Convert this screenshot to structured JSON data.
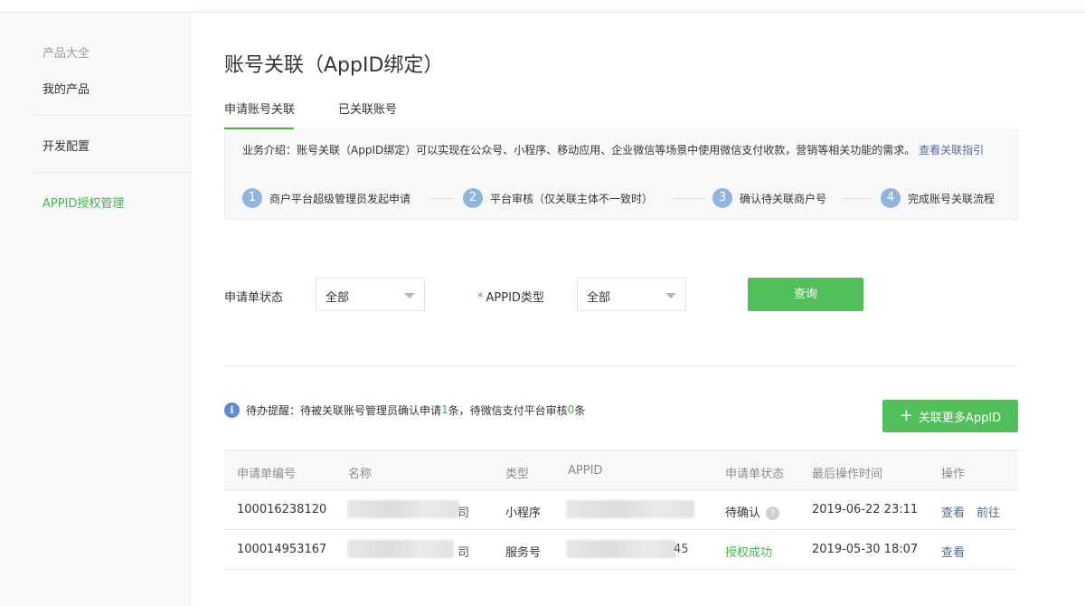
{
  "sidebar": {
    "caption": "产品大全",
    "items": [
      {
        "label": "我的产品"
      },
      {
        "label": "开发配置"
      },
      {
        "label": "APPID授权管理"
      }
    ]
  },
  "page": {
    "title": "账号关联（AppID绑定）"
  },
  "tabs": [
    {
      "label": "申请账号关联",
      "active": true
    },
    {
      "label": "已关联账号",
      "active": false
    }
  ],
  "intro": {
    "text": "业务介绍：账号关联（AppID绑定）可以实现在公众号、小程序、移动应用、企业微信等场景中使用微信支付收款，营销等相关功能的需求。",
    "link": "查看关联指引",
    "steps": [
      {
        "num": "1",
        "label": "商户平台超级管理员发起申请"
      },
      {
        "num": "2",
        "label": "平台审核（仅关联主体不一致时）"
      },
      {
        "num": "3",
        "label": "确认待关联商户号"
      },
      {
        "num": "4",
        "label": "完成账号关联流程"
      }
    ]
  },
  "filters": {
    "status_label": "申请单状态",
    "status_value": "全部",
    "required_mark": "*",
    "type_label": "APPID类型",
    "type_value": "全部",
    "query_button": "查询"
  },
  "notice": {
    "prefix": "待办提醒：待被关联账号管理员确认申请",
    "count1": "1",
    "middle": "条，待微信支付平台审核",
    "count2": "0",
    "suffix": "条"
  },
  "add_button": "关联更多AppID",
  "table": {
    "headers": [
      "申请单编号",
      "名称",
      "类型",
      "APPID",
      "申请单状态",
      "最后操作时间",
      "操作"
    ],
    "rows": [
      {
        "id": "100016238120",
        "name_tail": "司",
        "type": "小程序",
        "appid_tail": "",
        "status": "待确认",
        "time": "2019-06-22 23:11",
        "ops": [
          "查看",
          "前往"
        ]
      },
      {
        "id": "100014953167",
        "name_tail": "司",
        "type": "服务号",
        "appid_tail": "45",
        "status": "授权成功",
        "time": "2019-05-30 18:07",
        "ops": [
          "查看"
        ]
      }
    ]
  },
  "colors": {
    "accent": "#44b549",
    "link": "#576b95"
  }
}
